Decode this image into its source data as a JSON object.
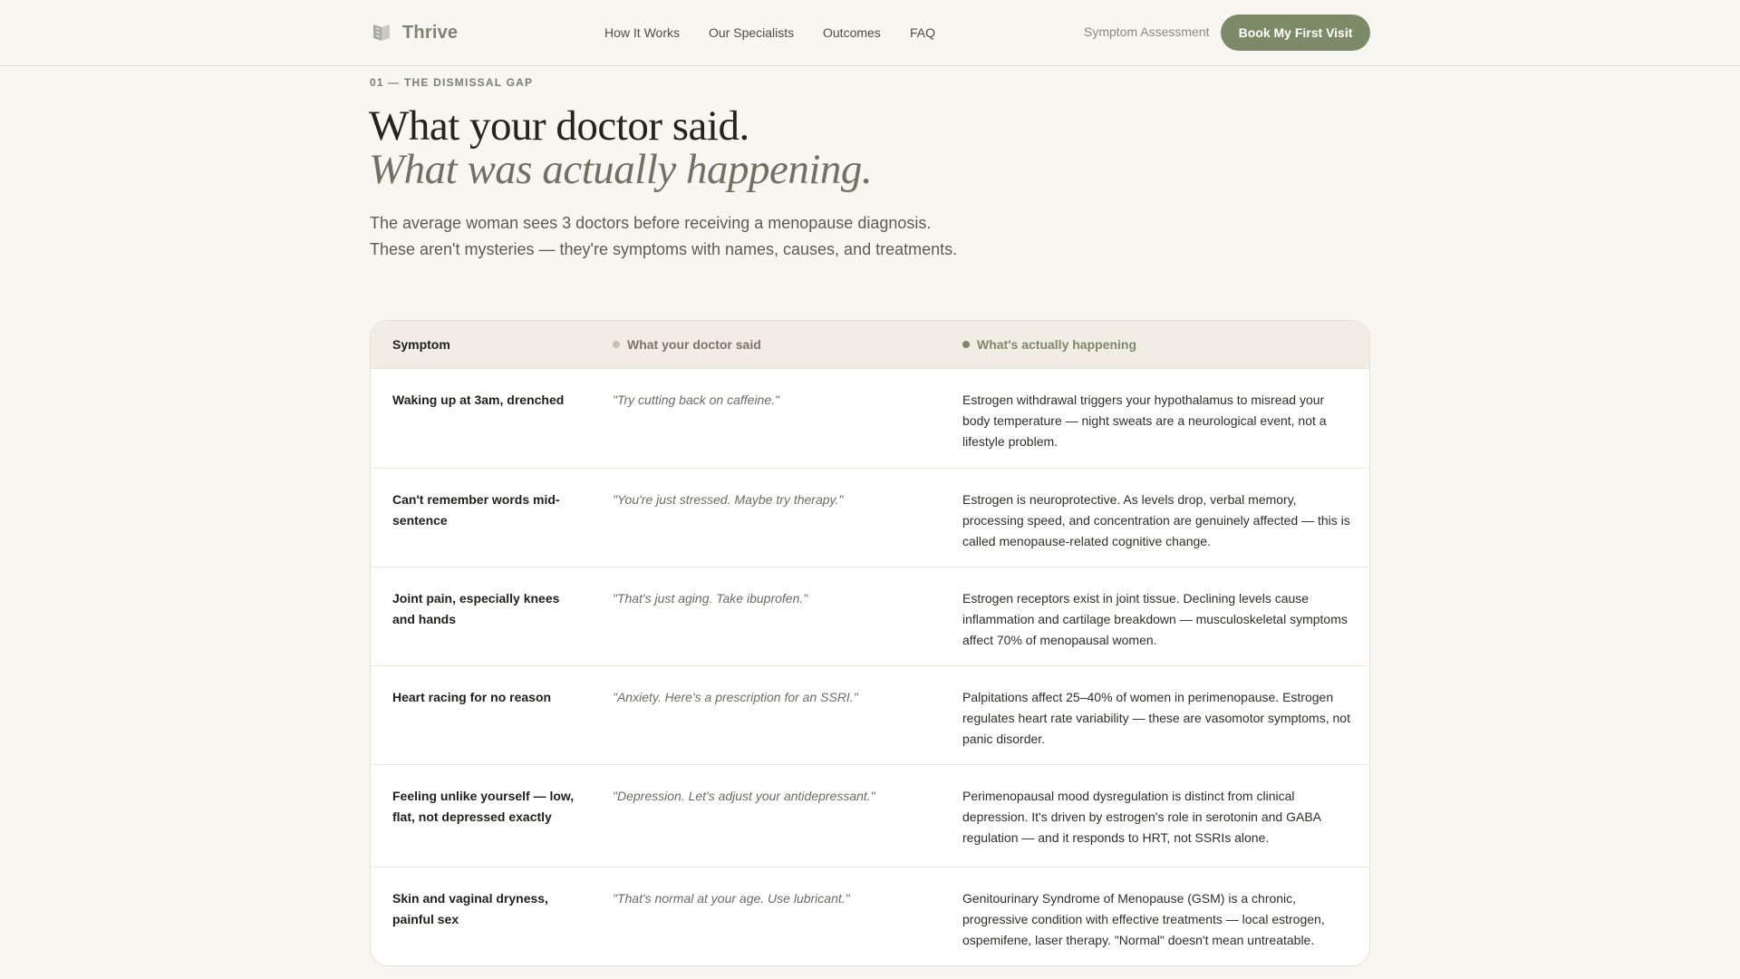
{
  "header": {
    "brand": "Thrive",
    "nav": [
      "How It Works",
      "Our Specialists",
      "Outcomes",
      "FAQ"
    ],
    "assessment_link": "Symptom Assessment",
    "cta": "Book My First Visit"
  },
  "hero": {
    "eyebrow": "01 — THE DISMISSAL GAP",
    "title_line1": "What your doctor said.",
    "title_line2": "What was actually happening.",
    "lede_line1": "The average woman sees 3 doctors before receiving a menopause diagnosis.",
    "lede_line2": "These aren't mysteries — they're symptoms with names, causes, and treatments."
  },
  "table": {
    "headers": [
      "Symptom",
      "What your doctor said",
      "What's actually happening"
    ],
    "header_dot_colors": [
      "#c9c1b0",
      "#7b8a67"
    ],
    "rows": [
      {
        "symptom": "Waking up at 3am, drenched",
        "doctor": "\"Try cutting back on caffeine.\"",
        "actual": "Estrogen withdrawal triggers your hypothalamus to misread your body temperature — night sweats are a neurological event, not a lifestyle problem."
      },
      {
        "symptom": "Can't remember words mid-sentence",
        "doctor": "\"You're just stressed. Maybe try therapy.\"",
        "actual": "Estrogen is neuroprotective. As levels drop, verbal memory, processing speed, and concentration are genuinely affected — this is called menopause-related cognitive change."
      },
      {
        "symptom": "Joint pain, especially knees and hands",
        "doctor": "\"That's just aging. Take ibuprofen.\"",
        "actual": "Estrogen receptors exist in joint tissue. Declining levels cause inflammation and cartilage breakdown — musculoskeletal symptoms affect 70% of menopausal women."
      },
      {
        "symptom": "Heart racing for no reason",
        "doctor": "\"Anxiety. Here's a prescription for an SSRI.\"",
        "actual": "Palpitations affect 25–40% of women in perimenopause. Estrogen regulates heart rate variability — these are vasomotor symptoms, not panic disorder."
      },
      {
        "symptom": "Feeling unlike yourself — low, flat, not depressed exactly",
        "doctor": "\"Depression. Let's adjust your antidepressant.\"",
        "actual": "Perimenopausal mood dysregulation is distinct from clinical depression. It's driven by estrogen's role in serotonin and GABA regulation — and it responds to HRT, not SSRIs alone."
      },
      {
        "symptom": "Skin and vaginal dryness, painful sex",
        "doctor": "\"That's normal at your age. Use lubricant.\"",
        "actual": "Genitourinary Syndrome of Menopause (GSM) is a chronic, progressive condition with effective treatments — local estrogen, ospemifene, laser therapy. \"Normal\" doesn't mean untreatable."
      }
    ]
  },
  "colors": {
    "accent": "#7b8a67",
    "background": "#f7f6f1",
    "table_header_bg": "#f2ede4"
  }
}
